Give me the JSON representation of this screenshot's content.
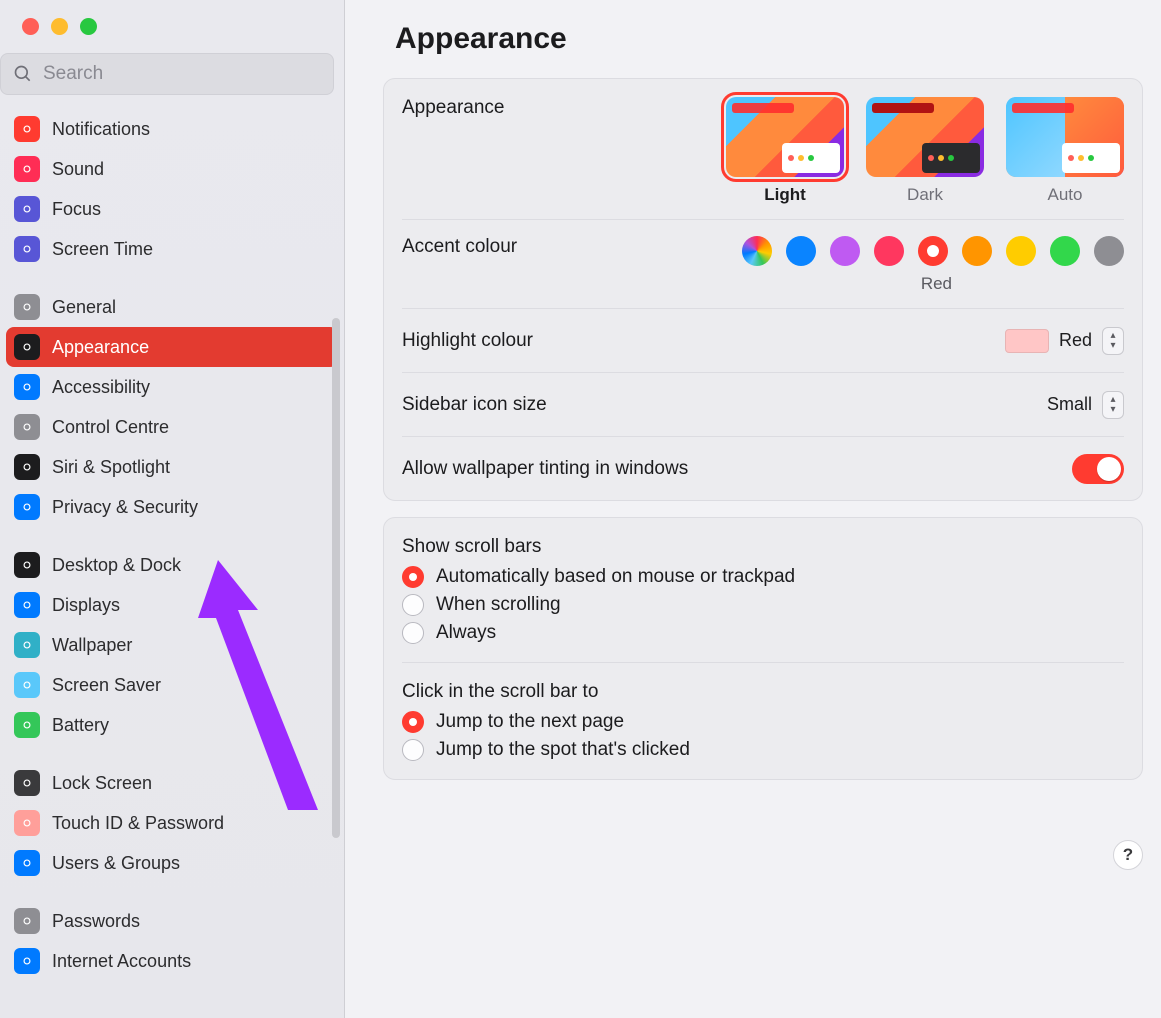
{
  "search": {
    "placeholder": "Search"
  },
  "page_title": "Appearance",
  "sidebar": {
    "groups": [
      [
        {
          "label": "Notifications",
          "icon": "bell-icon",
          "color": "red"
        },
        {
          "label": "Sound",
          "icon": "speaker-icon",
          "color": "pink"
        },
        {
          "label": "Focus",
          "icon": "moon-icon",
          "color": "indigo"
        },
        {
          "label": "Screen Time",
          "icon": "hourglass-icon",
          "color": "indigo"
        }
      ],
      [
        {
          "label": "General",
          "icon": "gear-icon",
          "color": "gray"
        },
        {
          "label": "Appearance",
          "icon": "appearance-icon",
          "color": "black",
          "selected": true
        },
        {
          "label": "Accessibility",
          "icon": "accessibility-icon",
          "color": "blue"
        },
        {
          "label": "Control Centre",
          "icon": "switches-icon",
          "color": "gray"
        },
        {
          "label": "Siri & Spotlight",
          "icon": "siri-icon",
          "color": "black"
        },
        {
          "label": "Privacy & Security",
          "icon": "hand-icon",
          "color": "blue"
        }
      ],
      [
        {
          "label": "Desktop & Dock",
          "icon": "dock-icon",
          "color": "black"
        },
        {
          "label": "Displays",
          "icon": "display-icon",
          "color": "blue"
        },
        {
          "label": "Wallpaper",
          "icon": "wallpaper-icon",
          "color": "teal"
        },
        {
          "label": "Screen Saver",
          "icon": "screensaver-icon",
          "color": "cyan"
        },
        {
          "label": "Battery",
          "icon": "battery-icon",
          "color": "green"
        }
      ],
      [
        {
          "label": "Lock Screen",
          "icon": "lock-icon",
          "color": "darkgray"
        },
        {
          "label": "Touch ID & Password",
          "icon": "fingerprint-icon",
          "color": "peach"
        },
        {
          "label": "Users & Groups",
          "icon": "users-icon",
          "color": "blue"
        }
      ],
      [
        {
          "label": "Passwords",
          "icon": "key-icon",
          "color": "gray"
        },
        {
          "label": "Internet Accounts",
          "icon": "at-icon",
          "color": "blue"
        }
      ]
    ]
  },
  "appearance_row": {
    "label": "Appearance",
    "options": [
      {
        "label": "Light",
        "selected": true
      },
      {
        "label": "Dark"
      },
      {
        "label": "Auto"
      }
    ]
  },
  "accent": {
    "label": "Accent colour",
    "selected_index": 4,
    "selected_label": "Red",
    "colors": [
      "multicolour",
      "#0a84ff",
      "#bf5af2",
      "#ff375f",
      "#ff3b30",
      "#ff9500",
      "#ffcc00",
      "#32d74b",
      "#8e8e93"
    ]
  },
  "highlight": {
    "label": "Highlight colour",
    "value": "Red",
    "swatch": "#ffc6c6"
  },
  "sidebar_icon": {
    "label": "Sidebar icon size",
    "value": "Small"
  },
  "tinting": {
    "label": "Allow wallpaper tinting in windows",
    "on": true
  },
  "scrollbars": {
    "label": "Show scroll bars",
    "options": [
      "Automatically based on mouse or trackpad",
      "When scrolling",
      "Always"
    ],
    "selected": 0
  },
  "click_scroll": {
    "label": "Click in the scroll bar to",
    "options": [
      "Jump to the next page",
      "Jump to the spot that's clicked"
    ],
    "selected": 0
  },
  "help_glyph": "?",
  "arrow_color": "#9b2bff"
}
